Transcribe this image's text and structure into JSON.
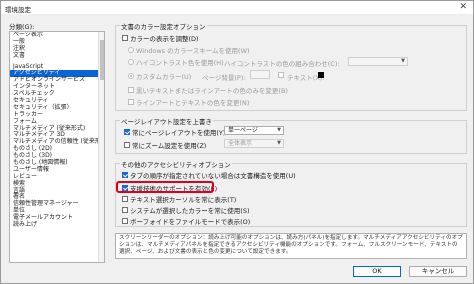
{
  "window": {
    "title": "環境設定",
    "close_glyph": "✕"
  },
  "categories_label": "分類(G):",
  "categories": [
    "ページ表示",
    "一般",
    "注釈",
    "文書",
    "JavaScript",
    "アクセシビリティ",
    "アドビオンラインサービス",
    "インターネット",
    "スペルチェック",
    "セキュリティ",
    "セキュリティ（拡張）",
    "トラッカー",
    "フォーム",
    "マルチメディア (従来形式)",
    "マルチメディア 3D",
    "マルチメディアの信頼性 (従来形式)",
    "ものさし (2D)",
    "ものさし (3D)",
    "ものさし (地図情報)",
    "ユーザー情報",
    "レビュー",
    "検索",
    "言語",
    "署名",
    "信頼性管理マネージャー",
    "単位",
    "電子メールアカウント",
    "読み上げ"
  ],
  "selected_category": "アクセシビリティ",
  "color_group": {
    "title": "文書のカラー設定オプション",
    "replace_colors": "カラーの表示を調整(D)",
    "windows_scheme": "Windows のカラースキームを使用(W)",
    "high_contrast": "ハイコントラスト色を使用(H)",
    "high_contrast_label": "ハイコントラストの色の組み合わせ(C):",
    "custom_color": "カスタムカラー(U)",
    "page_bg": "ページ背景(P):",
    "text": "テキスト(X):",
    "black_text_only": "黒いテキストまたはラインアートの色のみを変更(B)",
    "lineart_text_change": "ラインアートとテキストの色を変更(N)"
  },
  "page_group": {
    "title": "ページレイアウト設定を上書き",
    "always_layout": "常にページレイアウトを使用(Y)",
    "layout_value": "単一ページ",
    "always_zoom": "常にズーム設定を使用(Z)",
    "zoom_value": "全体表示"
  },
  "other_group": {
    "title": "その他のアクセシビリティオプション",
    "tab_order": "タブの順序が指定されていない場合は文書構造を使用(U)",
    "assistive_tech": "支援技術のサポートを有効(E)",
    "text_cursor": "テキスト選択カーソルを常に表示(T)",
    "system_colors": "システムが選択したカラーを常に使用(S)",
    "focus_border": "ボーフォイドをファイルモードで表示(O)"
  },
  "description": "スクリーンリーダーのオプション：読み上げ可能のオプションは、読み方(パネル)を指定します。マルチメディアアクセシビリティのオプションは、マルチメディアパネルを指定できるアクセシビリティ機能のオプションです。フォーム、フルスクリーンモード、テキストの選択、ページ、および文書の表示と色の変更について設定できます。",
  "buttons": {
    "ok": "OK",
    "cancel": "キャンセル"
  }
}
